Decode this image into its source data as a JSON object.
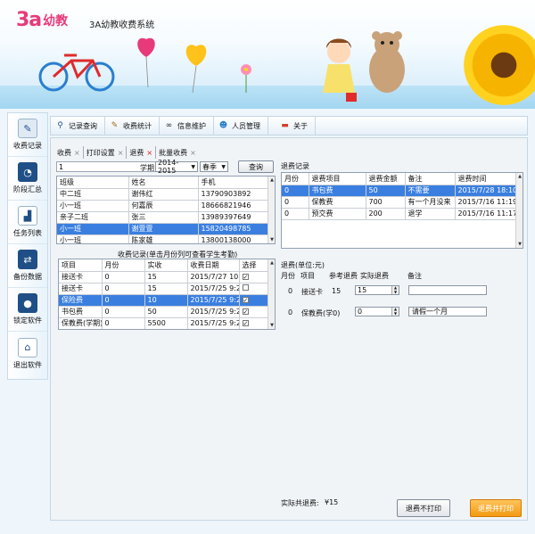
{
  "app": {
    "logo_text": "3a",
    "logo_word": "幼教",
    "title": "3A幼教收费系统"
  },
  "sidebar": {
    "items": [
      {
        "label": "收费记录",
        "icon": "notepad-icon"
      },
      {
        "label": "阶段汇总",
        "icon": "pie-chart-icon"
      },
      {
        "label": "任务列表",
        "icon": "bar-chart-icon"
      },
      {
        "label": "备份数据",
        "icon": "backup-icon"
      },
      {
        "label": "锁定软件",
        "icon": "lock-icon"
      },
      {
        "label": "退出软件",
        "icon": "exit-icon"
      }
    ]
  },
  "toolbar": {
    "items": [
      {
        "label": "记录查询",
        "icon": "magnifier-icon"
      },
      {
        "label": "收费统计",
        "icon": "notepad-icon"
      },
      {
        "label": "信息维护",
        "icon": "binoculars-icon"
      },
      {
        "label": "人员管理",
        "icon": "people-icon"
      },
      {
        "label": "关于",
        "icon": "about-icon"
      }
    ]
  },
  "tabs": [
    {
      "label": "收费",
      "close": "×"
    },
    {
      "label": "打印设置",
      "close": "×"
    },
    {
      "label": "退费",
      "close": "×"
    },
    {
      "label": "批量收费",
      "close": "×"
    }
  ],
  "search": {
    "value": "1",
    "term_label": "学期",
    "year": "2014-2015",
    "season": "春季",
    "query_button": "查询"
  },
  "students": {
    "headers": [
      "班级",
      "姓名",
      "手机"
    ],
    "rows": [
      [
        "中二班",
        "谢伟红",
        "13790903892"
      ],
      [
        "小一班",
        "何嘉辰",
        "18666821946"
      ],
      [
        "亲子二班",
        "张三",
        "13989397649"
      ],
      [
        "小一班",
        "谢萱萱",
        "15820498785"
      ],
      [
        "小一班",
        "陈家雄",
        "13800138000"
      ]
    ],
    "selected": 3
  },
  "fee_records": {
    "title": "收费记录(单击月份列可查看学生考勤)",
    "headers": [
      "项目",
      "月份",
      "实收",
      "收费日期",
      "选择"
    ],
    "rows": [
      [
        "接送卡",
        "0",
        "15",
        "2015/7/27 10:32",
        "✓"
      ],
      [
        "接送卡",
        "0",
        "15",
        "2015/7/25 9:28",
        ""
      ],
      [
        "保险费",
        "0",
        "10",
        "2015/7/25 9:28",
        "✓"
      ],
      [
        "书包费",
        "0",
        "50",
        "2015/7/25 9:28",
        "✓"
      ],
      [
        "保教费(学期)",
        "0",
        "5500",
        "2015/7/25 9:28",
        "✓"
      ]
    ],
    "selected": 2
  },
  "refund_records": {
    "title": "退费记录",
    "headers": [
      "月份",
      "退费项目",
      "退费金额",
      "备注",
      "退费时间"
    ],
    "rows": [
      [
        "0",
        "书包费",
        "50",
        "不需要",
        "2015/7/28 18:10"
      ],
      [
        "0",
        "保教费",
        "700",
        "有一个月没来",
        "2015/7/16 11:19"
      ],
      [
        "0",
        "预交费",
        "200",
        "退学",
        "2015/7/16 11:17"
      ]
    ],
    "selected": 0
  },
  "refund_form": {
    "title": "退费(单位:元)",
    "headers": [
      "月份",
      "项目",
      "参考退费",
      "实际退费",
      "备注"
    ],
    "rows": [
      {
        "month": "0",
        "item": "接送卡",
        "ref": "15",
        "actual": "15",
        "note": ""
      },
      {
        "month": "0",
        "item": "保教费(学0)",
        "ref": "",
        "actual": "0",
        "note": "请假一个月"
      }
    ],
    "total_label": "实际共退费:",
    "total_value": "¥15",
    "btn_no_print": "退费不打印",
    "btn_print": "退费并打印"
  },
  "colors": {
    "accent": "#3a7fe0",
    "orange": "#f6a21e"
  }
}
